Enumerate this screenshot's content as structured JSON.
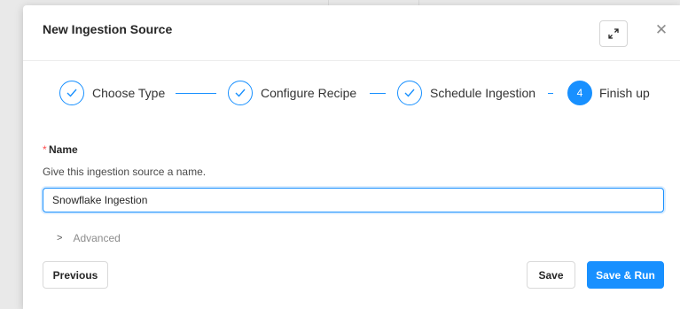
{
  "modal": {
    "title": "New Ingestion Source",
    "expand_icon": "expand-icon",
    "close_icon": "close-icon"
  },
  "steps": [
    {
      "label": "Choose Type",
      "state": "done"
    },
    {
      "label": "Configure Recipe",
      "state": "done"
    },
    {
      "label": "Schedule Ingestion",
      "state": "done"
    },
    {
      "label": "Finish up",
      "state": "current",
      "number": "4"
    }
  ],
  "form": {
    "required_mark": "*",
    "name_label": "Name",
    "name_help": "Give this ingestion source a name.",
    "name_value": "Snowflake Ingestion"
  },
  "advanced": {
    "label": "Advanced"
  },
  "footer": {
    "previous_label": "Previous",
    "save_label": "Save",
    "save_run_label": "Save & Run"
  },
  "colors": {
    "accent": "#1890ff",
    "required": "#ff4d4f"
  }
}
